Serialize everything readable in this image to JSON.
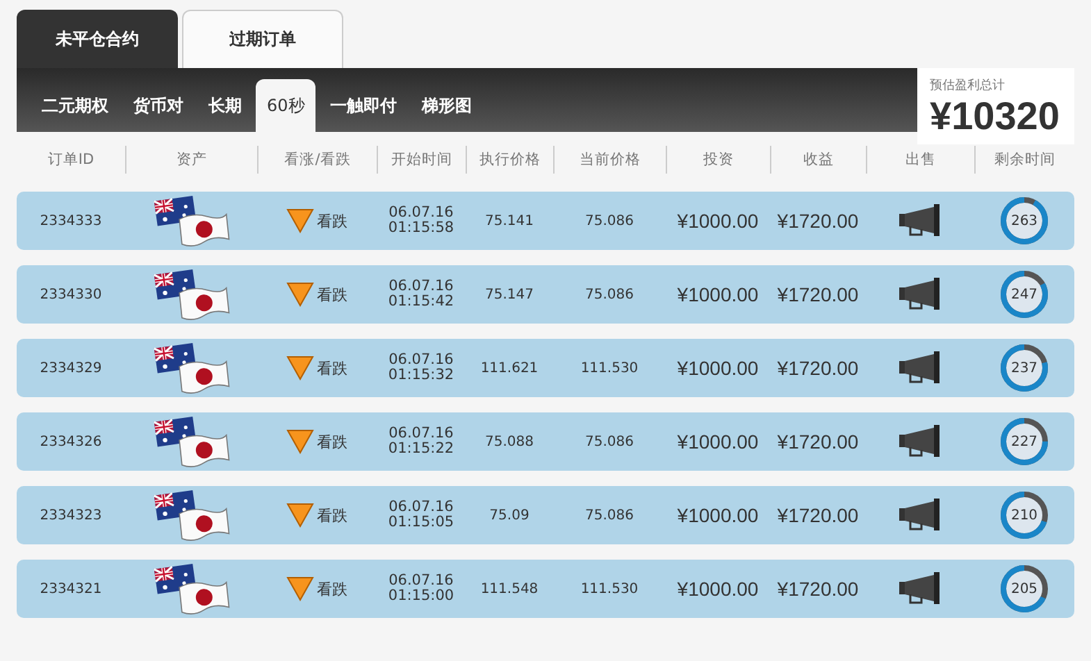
{
  "main_tabs": [
    {
      "label": "未平仓合约",
      "selected": true
    },
    {
      "label": "过期订单",
      "selected": false
    }
  ],
  "sub_tabs": [
    {
      "label": "二元期权",
      "selected": false
    },
    {
      "label": "货币对",
      "selected": false
    },
    {
      "label": "长期",
      "selected": false
    },
    {
      "label": "60秒",
      "selected": true
    },
    {
      "label": "一触即付",
      "selected": false
    },
    {
      "label": "梯形图",
      "selected": false
    }
  ],
  "summary": {
    "label": "预估盈利总计",
    "value": "¥10320"
  },
  "table": {
    "columns": [
      "订单ID",
      "资产",
      "看涨/看跌",
      "开始时间",
      "执行价格",
      "当前价格",
      "投资",
      "收益",
      "出售",
      "剩余时间"
    ],
    "rows": [
      {
        "id": "2334333",
        "direction": "看跌",
        "date": "06.07.16",
        "time": "01:15:58",
        "strike": "75.141",
        "current": "75.086",
        "investment": "¥1000.00",
        "payout": "¥1720.00",
        "remaining": "263",
        "level": 0.92
      },
      {
        "id": "2334330",
        "direction": "看跌",
        "date": "06.07.16",
        "time": "01:15:42",
        "strike": "75.147",
        "current": "75.086",
        "investment": "¥1000.00",
        "payout": "¥1720.00",
        "remaining": "247",
        "level": 0.83
      },
      {
        "id": "2334329",
        "direction": "看跌",
        "date": "06.07.16",
        "time": "01:15:32",
        "strike": "111.621",
        "current": "111.530",
        "investment": "¥1000.00",
        "payout": "¥1720.00",
        "remaining": "237",
        "level": 0.79
      },
      {
        "id": "2334326",
        "direction": "看跌",
        "date": "06.07.16",
        "time": "01:15:22",
        "strike": "75.088",
        "current": "75.086",
        "investment": "¥1000.00",
        "payout": "¥1720.00",
        "remaining": "227",
        "level": 0.75
      },
      {
        "id": "2334323",
        "direction": "看跌",
        "date": "06.07.16",
        "time": "01:15:05",
        "strike": "75.09",
        "current": "75.086",
        "investment": "¥1000.00",
        "payout": "¥1720.00",
        "remaining": "210",
        "level": 0.7
      },
      {
        "id": "2334321",
        "direction": "看跌",
        "date": "06.07.16",
        "time": "01:15:00",
        "strike": "111.548",
        "current": "111.530",
        "investment": "¥1000.00",
        "payout": "¥1720.00",
        "remaining": "205",
        "level": 0.68
      }
    ]
  }
}
